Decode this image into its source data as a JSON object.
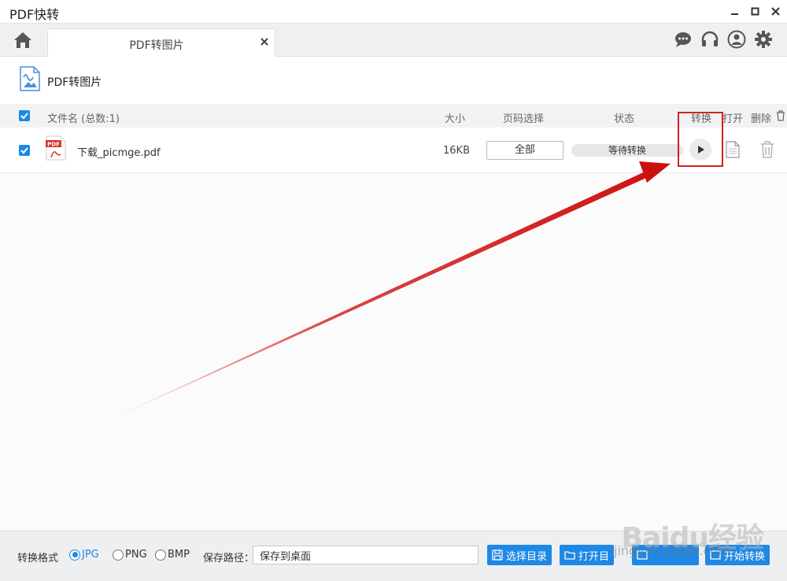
{
  "window": {
    "title": "PDF快转"
  },
  "tabs": [
    {
      "label": "PDF转图片"
    }
  ],
  "page": {
    "title": "PDF转图片"
  },
  "table": {
    "headers": {
      "name": "文件名 (总数:1)",
      "size": "大小",
      "range": "页码选择",
      "status": "状态",
      "convert": "转换",
      "open": "打开",
      "delete": "删除"
    },
    "rows": [
      {
        "name": "下载_picmge.pdf",
        "size": "16KB",
        "range": "全部",
        "status": "等待转换"
      }
    ]
  },
  "bottom": {
    "format_label": "转换格式",
    "formats": [
      {
        "label": "JPG",
        "selected": true
      },
      {
        "label": "PNG",
        "selected": false
      },
      {
        "label": "BMP",
        "selected": false
      }
    ],
    "path_label": "保存路径：",
    "path_value": "保存到桌面",
    "buttons": {
      "choose_dir": "选择目录",
      "open_dir": "打开目",
      "start": "开始转换"
    }
  },
  "watermark": {
    "brand": "Baidu经验",
    "url": "jingyan.baidu.com"
  },
  "colors": {
    "accent": "#1e88e5",
    "annotation": "#d32020"
  },
  "icons": [
    "home-icon",
    "chat-icon",
    "headset-icon",
    "user-icon",
    "gear-icon",
    "play-icon",
    "file-icon",
    "trash-icon",
    "pdf-file-icon"
  ]
}
